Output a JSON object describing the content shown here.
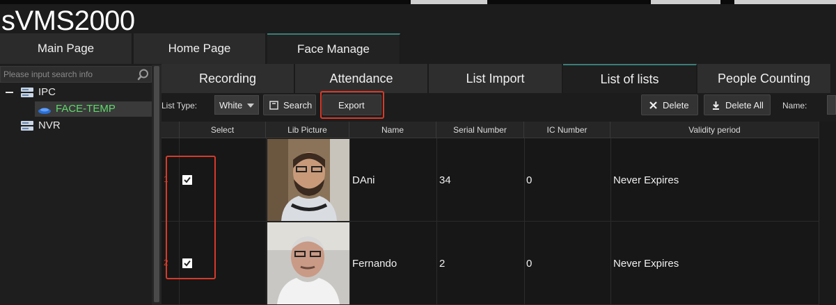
{
  "app": {
    "title": "sVMS2000"
  },
  "main_tabs": [
    {
      "label": "Main Page"
    },
    {
      "label": "Home Page"
    },
    {
      "label": "Face Manage"
    }
  ],
  "sidebar": {
    "search_placeholder": "Please input search info",
    "tree": [
      {
        "label": "IPC"
      },
      {
        "label": "FACE-TEMP"
      },
      {
        "label": "NVR"
      }
    ]
  },
  "sub_tabs": [
    {
      "label": "Recording"
    },
    {
      "label": "Attendance"
    },
    {
      "label": "List Import"
    },
    {
      "label": "List of lists"
    },
    {
      "label": "People Counting"
    }
  ],
  "toolbar": {
    "list_type_label": "List Type:",
    "list_type_value": "White",
    "search_label": "Search",
    "export_label": "Export",
    "delete_label": "Delete",
    "delete_all_label": "Delete All",
    "name_label": "Name:"
  },
  "table": {
    "columns": [
      "Select",
      "Lib Picture",
      "Name",
      "Serial Number",
      "IC Number",
      "Validity period"
    ],
    "rows": [
      {
        "index": "1",
        "checked": true,
        "name": "DAni",
        "serial": "34",
        "ic": "0",
        "validity": "Never Expires"
      },
      {
        "index": "2",
        "checked": true,
        "name": "Fernando",
        "serial": "2",
        "ic": "0",
        "validity": "Never Expires"
      }
    ]
  },
  "colors": {
    "accent_active_tab": "#3a7f78",
    "highlight_red": "#d83a2a",
    "selected_tree_text": "#5fd96a"
  }
}
